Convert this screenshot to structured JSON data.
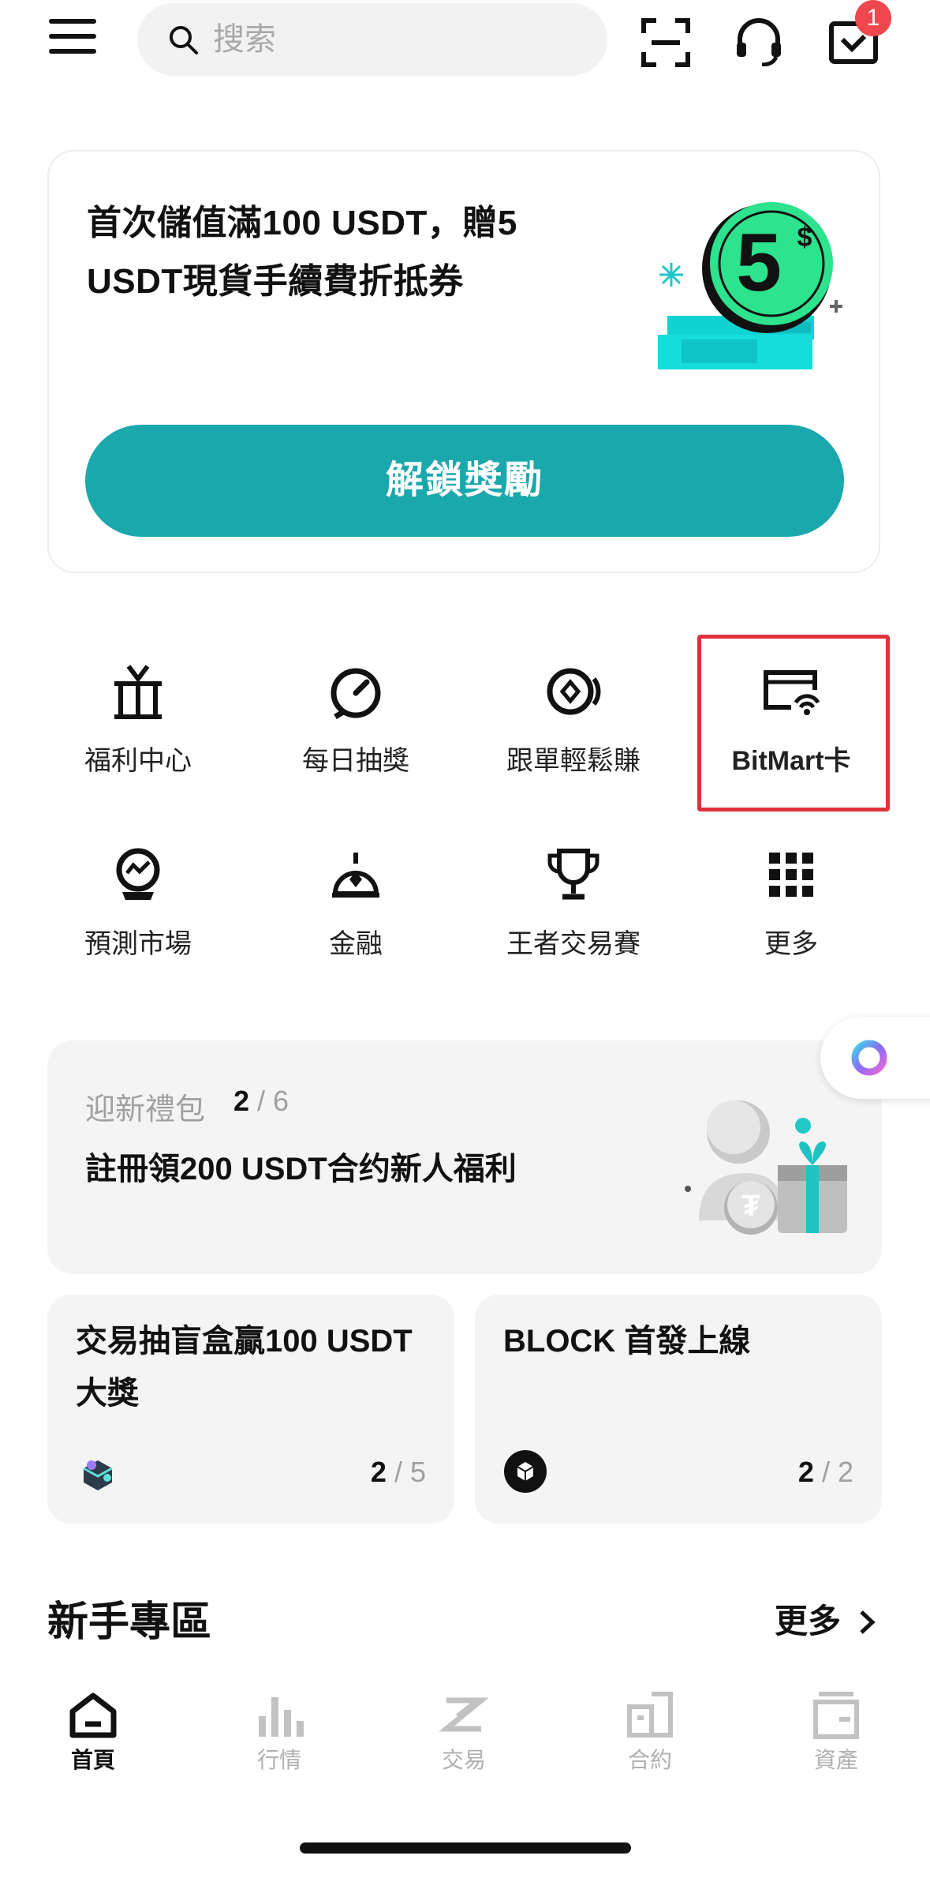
{
  "header": {
    "search_placeholder": "搜索",
    "notification_count": "1"
  },
  "promo": {
    "title": "首次儲值滿100 USDT，贈5 USDT現貨手續費折抵券",
    "coin_value": "5",
    "coin_unit": "$",
    "cta_label": "解鎖獎勵"
  },
  "quick_actions": [
    {
      "label": "福利中心",
      "icon": "gift-icon"
    },
    {
      "label": "每日抽獎",
      "icon": "lottery-wheel-icon"
    },
    {
      "label": "跟單輕鬆賺",
      "icon": "copy-trade-icon"
    },
    {
      "label": "BitMart卡",
      "icon": "card-contactless-icon"
    },
    {
      "label": "預測市場",
      "icon": "prediction-globe-icon"
    },
    {
      "label": "金融",
      "icon": "finance-icon"
    },
    {
      "label": "王者交易賽",
      "icon": "trophy-icon"
    },
    {
      "label": "更多",
      "icon": "grid-icon"
    }
  ],
  "newbie_pack": {
    "subtitle": "迎新禮包",
    "progress_done": "2",
    "progress_sep": " / ",
    "progress_total": "6",
    "title": "註冊領200 USDT合约新人福利"
  },
  "cards": [
    {
      "title": "交易抽盲盒贏100 USDT 大獎",
      "done": "2",
      "sep": " / ",
      "total": "5"
    },
    {
      "title": "BLOCK 首發上線",
      "done": "2",
      "sep": " / ",
      "total": "2"
    }
  ],
  "section": {
    "title": "新手專區",
    "more_label": "更多"
  },
  "nav": [
    {
      "label": "首頁",
      "icon": "home-icon",
      "active": true
    },
    {
      "label": "行情",
      "icon": "market-bars-icon"
    },
    {
      "label": "交易",
      "icon": "trade-icon"
    },
    {
      "label": "合約",
      "icon": "contract-icon"
    },
    {
      "label": "資產",
      "icon": "wallet-icon"
    }
  ],
  "colors": {
    "accent": "#1ba8ad",
    "badge": "#f0474f",
    "highlight_border": "#e0313d",
    "coin_green": "#2de38e"
  }
}
